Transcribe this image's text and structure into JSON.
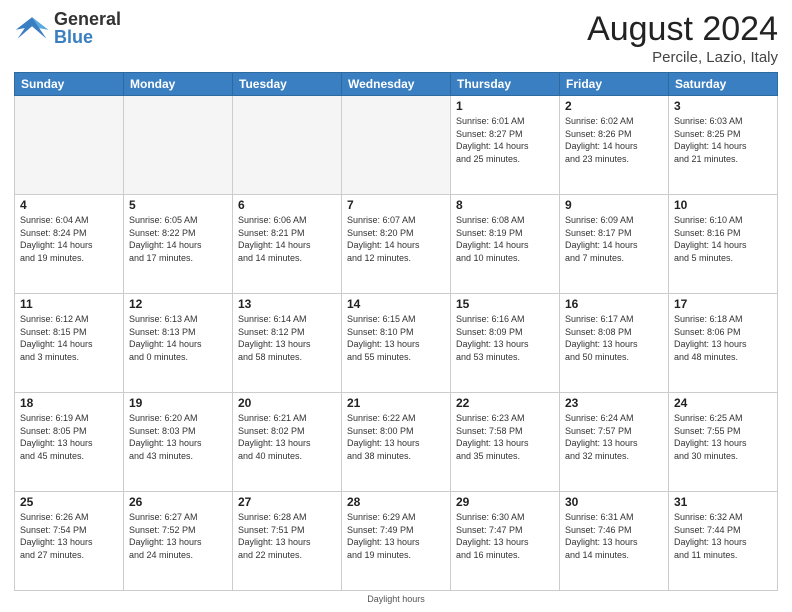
{
  "header": {
    "logo_general": "General",
    "logo_blue": "Blue",
    "month_year": "August 2024",
    "location": "Percile, Lazio, Italy"
  },
  "days_of_week": [
    "Sunday",
    "Monday",
    "Tuesday",
    "Wednesday",
    "Thursday",
    "Friday",
    "Saturday"
  ],
  "weeks": [
    [
      {
        "day": "",
        "info": ""
      },
      {
        "day": "",
        "info": ""
      },
      {
        "day": "",
        "info": ""
      },
      {
        "day": "",
        "info": ""
      },
      {
        "day": "1",
        "info": "Sunrise: 6:01 AM\nSunset: 8:27 PM\nDaylight: 14 hours\nand 25 minutes."
      },
      {
        "day": "2",
        "info": "Sunrise: 6:02 AM\nSunset: 8:26 PM\nDaylight: 14 hours\nand 23 minutes."
      },
      {
        "day": "3",
        "info": "Sunrise: 6:03 AM\nSunset: 8:25 PM\nDaylight: 14 hours\nand 21 minutes."
      }
    ],
    [
      {
        "day": "4",
        "info": "Sunrise: 6:04 AM\nSunset: 8:24 PM\nDaylight: 14 hours\nand 19 minutes."
      },
      {
        "day": "5",
        "info": "Sunrise: 6:05 AM\nSunset: 8:22 PM\nDaylight: 14 hours\nand 17 minutes."
      },
      {
        "day": "6",
        "info": "Sunrise: 6:06 AM\nSunset: 8:21 PM\nDaylight: 14 hours\nand 14 minutes."
      },
      {
        "day": "7",
        "info": "Sunrise: 6:07 AM\nSunset: 8:20 PM\nDaylight: 14 hours\nand 12 minutes."
      },
      {
        "day": "8",
        "info": "Sunrise: 6:08 AM\nSunset: 8:19 PM\nDaylight: 14 hours\nand 10 minutes."
      },
      {
        "day": "9",
        "info": "Sunrise: 6:09 AM\nSunset: 8:17 PM\nDaylight: 14 hours\nand 7 minutes."
      },
      {
        "day": "10",
        "info": "Sunrise: 6:10 AM\nSunset: 8:16 PM\nDaylight: 14 hours\nand 5 minutes."
      }
    ],
    [
      {
        "day": "11",
        "info": "Sunrise: 6:12 AM\nSunset: 8:15 PM\nDaylight: 14 hours\nand 3 minutes."
      },
      {
        "day": "12",
        "info": "Sunrise: 6:13 AM\nSunset: 8:13 PM\nDaylight: 14 hours\nand 0 minutes."
      },
      {
        "day": "13",
        "info": "Sunrise: 6:14 AM\nSunset: 8:12 PM\nDaylight: 13 hours\nand 58 minutes."
      },
      {
        "day": "14",
        "info": "Sunrise: 6:15 AM\nSunset: 8:10 PM\nDaylight: 13 hours\nand 55 minutes."
      },
      {
        "day": "15",
        "info": "Sunrise: 6:16 AM\nSunset: 8:09 PM\nDaylight: 13 hours\nand 53 minutes."
      },
      {
        "day": "16",
        "info": "Sunrise: 6:17 AM\nSunset: 8:08 PM\nDaylight: 13 hours\nand 50 minutes."
      },
      {
        "day": "17",
        "info": "Sunrise: 6:18 AM\nSunset: 8:06 PM\nDaylight: 13 hours\nand 48 minutes."
      }
    ],
    [
      {
        "day": "18",
        "info": "Sunrise: 6:19 AM\nSunset: 8:05 PM\nDaylight: 13 hours\nand 45 minutes."
      },
      {
        "day": "19",
        "info": "Sunrise: 6:20 AM\nSunset: 8:03 PM\nDaylight: 13 hours\nand 43 minutes."
      },
      {
        "day": "20",
        "info": "Sunrise: 6:21 AM\nSunset: 8:02 PM\nDaylight: 13 hours\nand 40 minutes."
      },
      {
        "day": "21",
        "info": "Sunrise: 6:22 AM\nSunset: 8:00 PM\nDaylight: 13 hours\nand 38 minutes."
      },
      {
        "day": "22",
        "info": "Sunrise: 6:23 AM\nSunset: 7:58 PM\nDaylight: 13 hours\nand 35 minutes."
      },
      {
        "day": "23",
        "info": "Sunrise: 6:24 AM\nSunset: 7:57 PM\nDaylight: 13 hours\nand 32 minutes."
      },
      {
        "day": "24",
        "info": "Sunrise: 6:25 AM\nSunset: 7:55 PM\nDaylight: 13 hours\nand 30 minutes."
      }
    ],
    [
      {
        "day": "25",
        "info": "Sunrise: 6:26 AM\nSunset: 7:54 PM\nDaylight: 13 hours\nand 27 minutes."
      },
      {
        "day": "26",
        "info": "Sunrise: 6:27 AM\nSunset: 7:52 PM\nDaylight: 13 hours\nand 24 minutes."
      },
      {
        "day": "27",
        "info": "Sunrise: 6:28 AM\nSunset: 7:51 PM\nDaylight: 13 hours\nand 22 minutes."
      },
      {
        "day": "28",
        "info": "Sunrise: 6:29 AM\nSunset: 7:49 PM\nDaylight: 13 hours\nand 19 minutes."
      },
      {
        "day": "29",
        "info": "Sunrise: 6:30 AM\nSunset: 7:47 PM\nDaylight: 13 hours\nand 16 minutes."
      },
      {
        "day": "30",
        "info": "Sunrise: 6:31 AM\nSunset: 7:46 PM\nDaylight: 13 hours\nand 14 minutes."
      },
      {
        "day": "31",
        "info": "Sunrise: 6:32 AM\nSunset: 7:44 PM\nDaylight: 13 hours\nand 11 minutes."
      }
    ]
  ],
  "footer": {
    "note": "Daylight hours"
  }
}
